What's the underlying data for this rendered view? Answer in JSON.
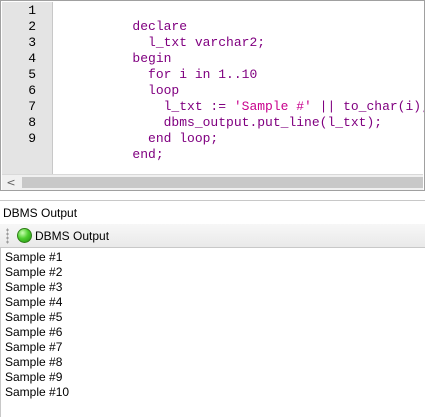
{
  "editor": {
    "line_numbers": [
      "1",
      "2",
      "3",
      "4",
      "5",
      "6",
      "7",
      "8",
      "9"
    ],
    "lines": [
      [
        {
          "text": "declare",
          "kind": "kw"
        }
      ],
      [
        {
          "text": "  l_txt varchar2;",
          "kind": "kw"
        }
      ],
      [
        {
          "text": "begin",
          "kind": "kw"
        }
      ],
      [
        {
          "text": "  for i in 1..10",
          "kind": "kw"
        }
      ],
      [
        {
          "text": "  loop",
          "kind": "kw"
        }
      ],
      [
        {
          "text": "    l_txt := ",
          "kind": "kw"
        },
        {
          "text": "'Sample #'",
          "kind": "str"
        },
        {
          "text": " || to_char(i);",
          "kind": "kw"
        }
      ],
      [
        {
          "text": "    dbms_output.put_line(l_txt);",
          "kind": "kw"
        }
      ],
      [
        {
          "text": "  end loop;",
          "kind": "kw"
        }
      ],
      [
        {
          "text": "end;",
          "kind": "kw"
        }
      ]
    ],
    "scroll_left_glyph": "<",
    "colors": {
      "keyword": "#800080",
      "string": "#c8008c"
    }
  },
  "panel": {
    "title": "DBMS Output",
    "toolbar_button_label": "DBMS Output",
    "output_lines": [
      "Sample #1",
      "Sample #2",
      "Sample #3",
      "Sample #4",
      "Sample #5",
      "Sample #6",
      "Sample #7",
      "Sample #8",
      "Sample #9",
      "Sample #10"
    ]
  }
}
